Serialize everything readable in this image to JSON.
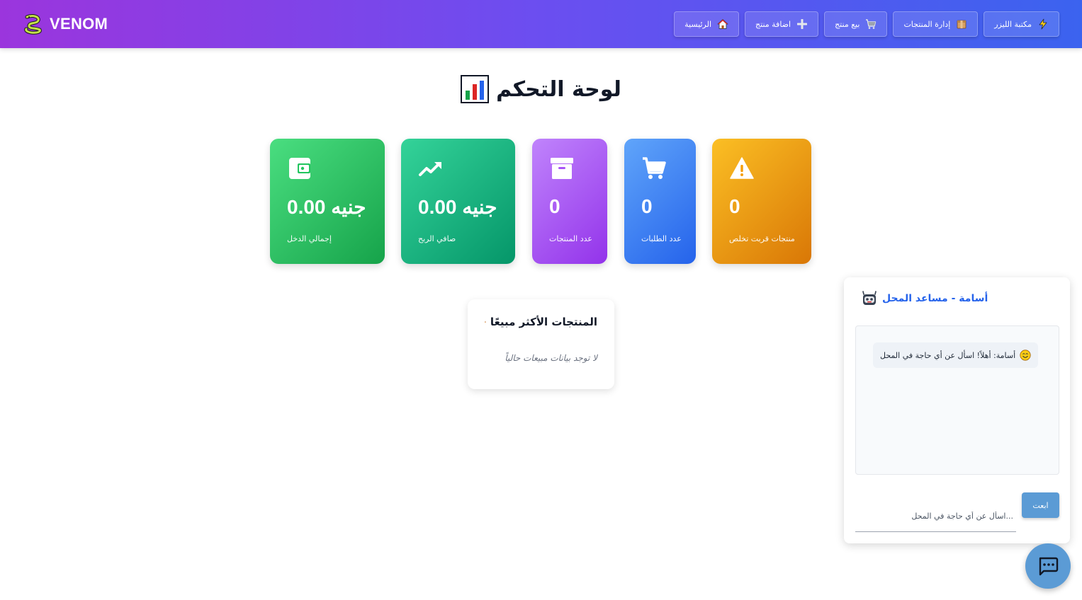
{
  "brand": {
    "name": "VENOM",
    "logo_icon": "snake-icon"
  },
  "nav": [
    {
      "label": "مكتبة الليزر",
      "icon": "lightning-icon"
    },
    {
      "label": "إدارة المنتجات",
      "icon": "box-icon"
    },
    {
      "label": "بيع منتج",
      "icon": "cart-icon"
    },
    {
      "label": "اضافة منتج",
      "icon": "plus-icon"
    },
    {
      "label": "الرئيسية",
      "icon": "home-icon"
    }
  ],
  "page": {
    "title": "لوحة التحكم",
    "title_icon": "bar-chart-icon"
  },
  "stats": {
    "income": {
      "value": "0.00 جنيه",
      "label": "إجمالي الدخل",
      "icon": "wallet-icon"
    },
    "profit": {
      "value": "0.00 جنيه",
      "label": "صافي الربح",
      "icon": "trending-up-icon"
    },
    "products": {
      "value": "0",
      "label": "عدد المنتجات",
      "icon": "archive-icon"
    },
    "orders": {
      "value": "0",
      "label": "عدد الطلبات",
      "icon": "cart-icon"
    },
    "low_stock": {
      "value": "0",
      "label": "منتجات قربت تخلص",
      "icon": "warning-icon"
    }
  },
  "top_products": {
    "title": "المنتجات الأكثر مبيعًا",
    "icon": "fire-icon",
    "empty_text": "لا توجد بيانات مبيعات حالياً"
  },
  "assistant": {
    "title": "أسامة - مساعد المحل",
    "icon": "robot-icon",
    "welcome_message": "أسامة: أهلاً! اسأل عن أي حاجة في المحل",
    "input_placeholder": "اسأل عن أي حاجة في المحل...",
    "send_label": "ابعت"
  },
  "fab": {
    "icon": "chat-icon"
  },
  "colors": {
    "header_gradient": [
      "#9b35dd",
      "#6b4ef0",
      "#3b63ef"
    ],
    "accent_blue": "#2563eb",
    "send_button": "#5b9bd5"
  }
}
